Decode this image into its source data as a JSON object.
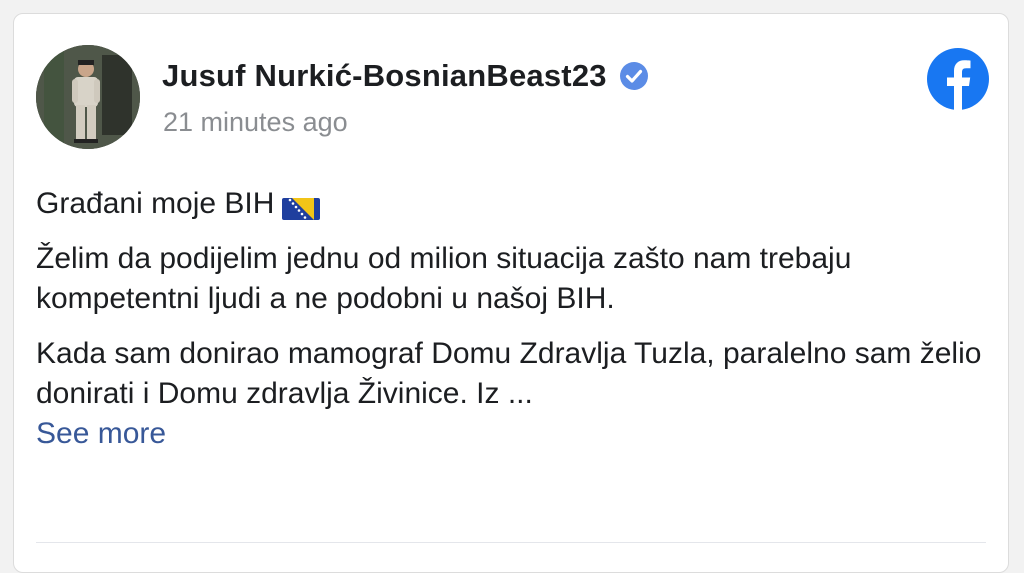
{
  "post": {
    "author_name": "Jusuf Nurkić-BosnianBeast23",
    "timestamp": "21 minutes ago",
    "greeting": "Građani moje BIH",
    "paragraph_1": "Želim da podijelim jednu od milion situacija zašto nam trebaju kompetentni ljudi a ne podobni u našoj BIH.",
    "paragraph_2": "Kada sam donirao mamograf Domu Zdravlja Tuzla, paralelno sam želio donirati i Domu zdravlja Živinice. Iz ...",
    "see_more_label": "See more"
  },
  "icons": {
    "verified": "verified-badge-icon",
    "facebook": "facebook-logo-icon",
    "flag": "bosnia-flag-icon"
  },
  "colors": {
    "link": "#385898",
    "facebook_blue": "#1877f2",
    "verified_blue": "#5b8ce6",
    "text": "#1c1e21",
    "muted": "#8a8d91"
  }
}
